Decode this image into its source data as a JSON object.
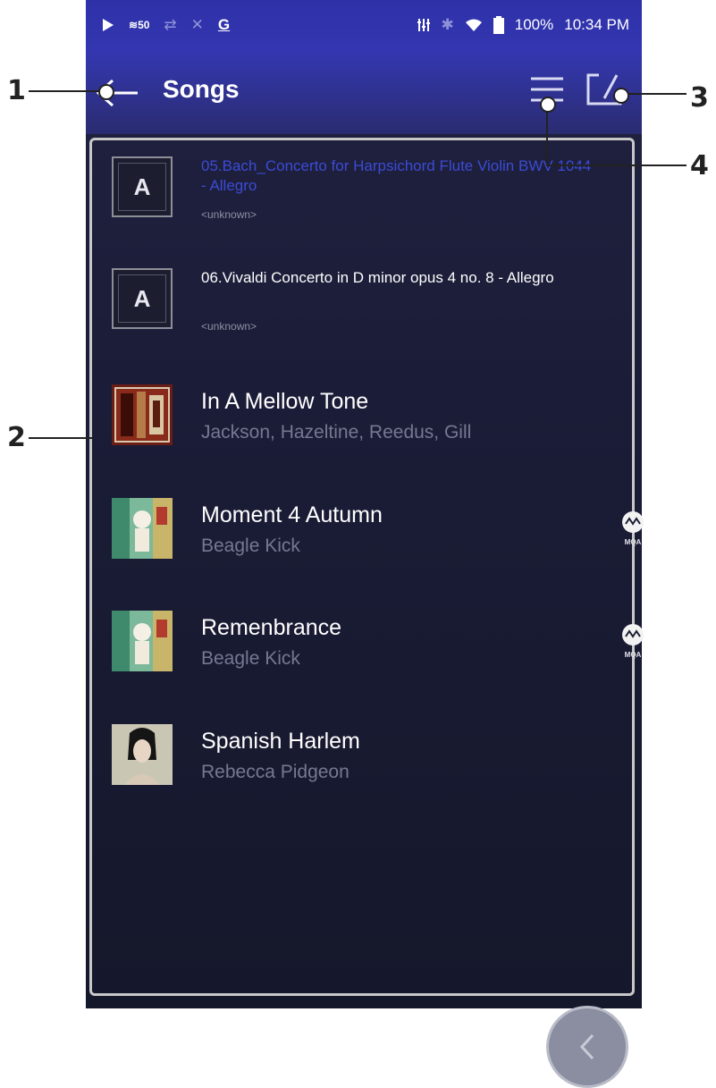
{
  "status_bar": {
    "quality": "50",
    "battery": "100%",
    "time": "10:34 PM"
  },
  "header": {
    "title": "Songs"
  },
  "songs": [
    {
      "title": "05.Bach_Concerto for Harpsichord Flute Violin BWV 1044 - Allegro",
      "artist": "<unknown>",
      "thumb": "a-logo",
      "playing": true
    },
    {
      "title": "06.Vivaldi Concerto in D minor opus 4 no. 8 - Allegro",
      "artist": "<unknown>",
      "thumb": "a-logo",
      "playing": false
    },
    {
      "title": "In A Mellow Tone",
      "artist": "Jackson, Hazeltine, Reedus, Gill",
      "thumb": "album-art",
      "playing": false
    },
    {
      "title": "Moment 4 Autumn",
      "artist": "Beagle Kick",
      "thumb": "album-art",
      "mqa": true,
      "playing": false
    },
    {
      "title": "Remenbrance",
      "artist": "Beagle Kick",
      "thumb": "album-art",
      "mqa": true,
      "playing": false
    },
    {
      "title": "Spanish Harlem",
      "artist": "Rebecca Pidgeon",
      "thumb": "album-art",
      "playing": false
    }
  ],
  "callouts": [
    "1",
    "2",
    "3",
    "4"
  ],
  "mqa_label": "MQA",
  "logo_letter": "A",
  "colors": {
    "header": "#3336b0",
    "background": "#1a1c33",
    "playing_title": "#3c4bd6"
  }
}
